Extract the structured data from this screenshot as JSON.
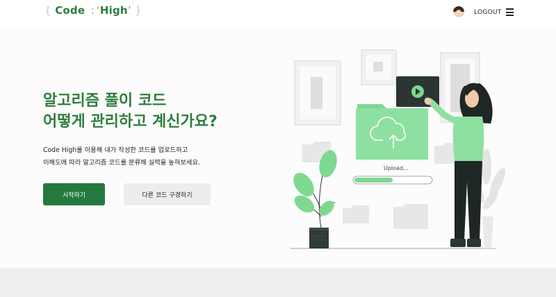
{
  "header": {
    "logo": {
      "open": "{",
      "word1": "Code",
      "colon": ":",
      "word2": "High",
      "close": "}"
    },
    "logout_label": "LOGOUT"
  },
  "hero": {
    "title_lines": [
      "알고리즘 풀이 코드",
      "어떻게 관리하고 계신가요?"
    ],
    "description_lines": [
      "Code High를 이용해 내가 작성한 코드를 업로드하고",
      "이해도에 따라 알고리즘 코드를 분류해 실력을 높혀보세요."
    ],
    "start_button": "시작하기",
    "browse_button": "다른 코드 구경하기"
  },
  "illustration": {
    "upload_label": "Upload...",
    "upload_progress": 0.5
  },
  "colors": {
    "brand_green": "#2e7d3e",
    "accent_green": "#8ee0a0",
    "button_green": "#247a3e"
  }
}
